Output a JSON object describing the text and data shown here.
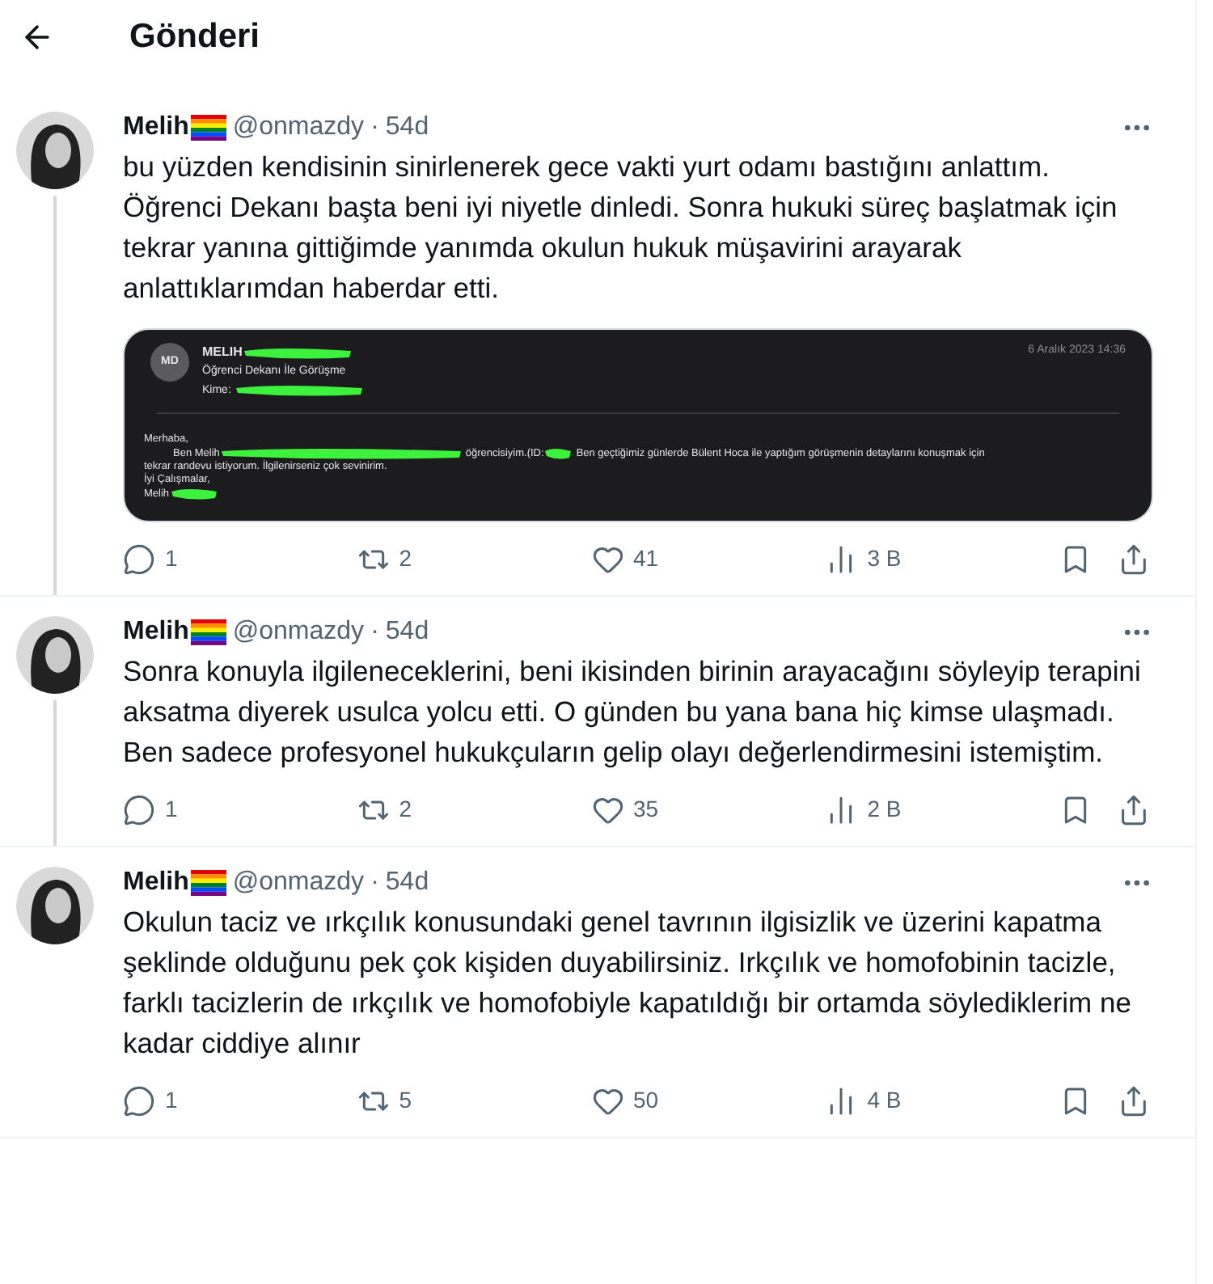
{
  "header": {
    "title": "Gönderi"
  },
  "posts": [
    {
      "name": "Melih",
      "handle": "@onmazdy",
      "dot": "·",
      "time": "54d",
      "text": "bu yüzden kendisinin sinirlenerek gece vakti yurt odamı bastığını anlattım. Öğrenci Dekanı başta beni iyi niyetle dinledi. Sonra hukuki süreç başlatmak için tekrar yanına gittiğimde yanımda okulun hukuk müşavirini arayarak anlattıklarımdan haberdar etti.",
      "email": {
        "initials": "MD",
        "sender": "MELIH",
        "subject": "Öğrenci Dekanı İle Görüşme",
        "to_label": "Kime:",
        "date": "6 Aralık 2023 14:36",
        "greeting": "Merhaba,",
        "line1_start": "Ben Melih",
        "line1_mid": "öğrencisiyim.(ID:",
        "line1_end": "Ben geçtiğimiz günlerde Bülent Hoca ile  yaptığım görüşmenin detaylarını konuşmak için",
        "line2": "tekrar randevu istiyorum. İlgilenirseniz çok sevinirim.",
        "closing": "İyi Çalışmalar,",
        "signature": "Melih"
      },
      "replies": "1",
      "reposts": "2",
      "likes": "41",
      "views": "3 B"
    },
    {
      "name": "Melih",
      "handle": "@onmazdy",
      "dot": "·",
      "time": "54d",
      "text": "Sonra konuyla ilgileneceklerini, beni ikisinden birinin arayacağını söyleyip terapini aksatma diyerek usulca yolcu etti. O günden bu yana bana hiç kimse ulaşmadı. Ben sadece profesyonel hukukçuların gelip olayı değerlendirmesini istemiştim.",
      "replies": "1",
      "reposts": "2",
      "likes": "35",
      "views": "2 B"
    },
    {
      "name": "Melih",
      "handle": "@onmazdy",
      "dot": "·",
      "time": "54d",
      "text": "Okulun taciz ve ırkçılık konusundaki genel tavrının ilgisizlik ve üzerini kapatma şeklinde olduğunu pek çok kişiden duyabilirsiniz. Irkçılık ve homofobinin tacizle, farklı tacizlerin de ırkçılık ve homofobiyle kapatıldığı bir ortamda söylediklerim ne kadar ciddiye alınır",
      "replies": "1",
      "reposts": "5",
      "likes": "50",
      "views": "4 B"
    }
  ]
}
